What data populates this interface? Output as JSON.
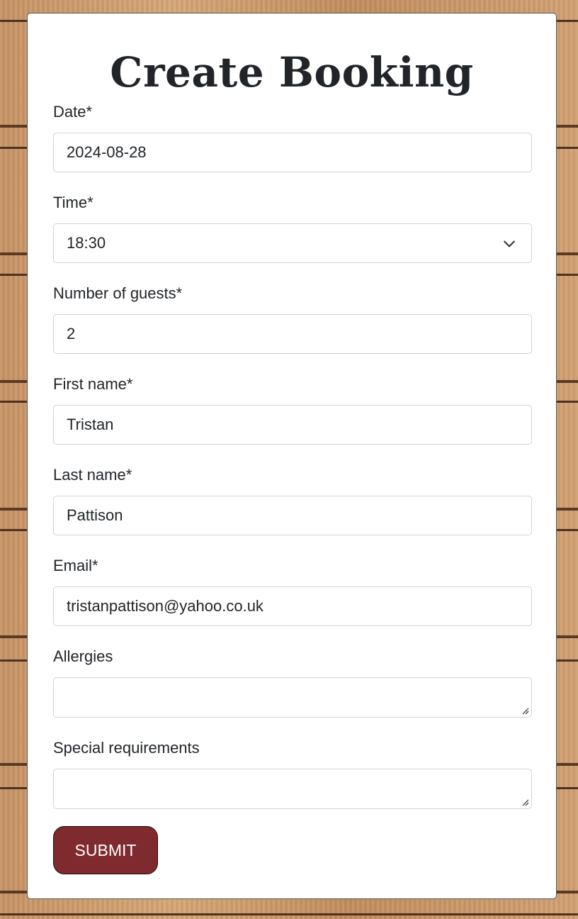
{
  "form": {
    "title": "Create Booking",
    "fields": {
      "date": {
        "label": "Date*",
        "value": "2024-08-28"
      },
      "time": {
        "label": "Time*",
        "value": "18:30"
      },
      "guests": {
        "label": "Number of guests*",
        "value": "2"
      },
      "first_name": {
        "label": "First name*",
        "value": "Tristan"
      },
      "last_name": {
        "label": "Last name*",
        "value": "Pattison"
      },
      "email": {
        "label": "Email*",
        "value": "tristanpattison@yahoo.co.uk"
      },
      "allergies": {
        "label": "Allergies",
        "value": ""
      },
      "special_requirements": {
        "label": "Special requirements",
        "value": ""
      }
    },
    "submit_label": "SUBMIT"
  },
  "icons": {
    "time_dropdown": "chevron-down-icon",
    "textarea_resize": "resize-handle-icon"
  },
  "colors": {
    "submit_background": "#7f2a2e",
    "card_background": "#ffffff",
    "input_border": "#ced4da",
    "text": "#212529"
  }
}
